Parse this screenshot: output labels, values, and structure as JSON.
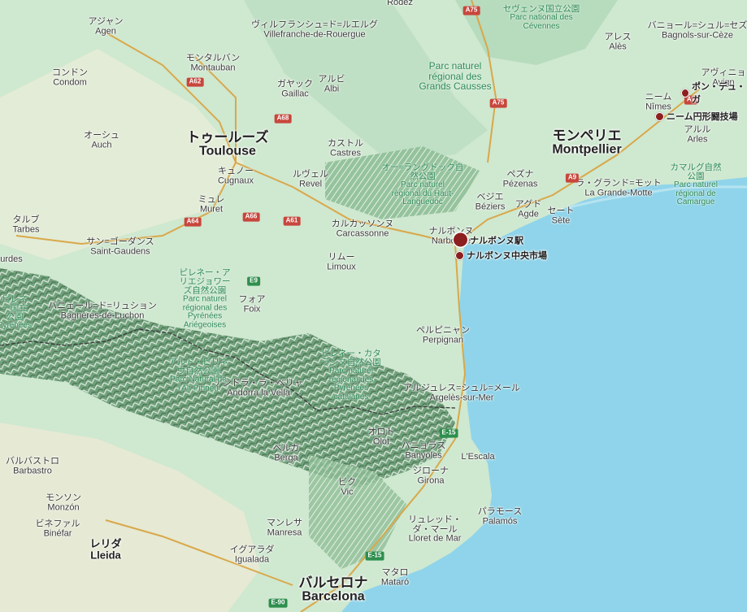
{
  "colors": {
    "sea": "#8fd4ea",
    "land": "#cfe8d0",
    "lowland": "#e6ecd8",
    "mountain": "#7fb68a",
    "border": "#3b3b3b",
    "motorway": "#d9a84a",
    "poi": "#8c1f1f"
  },
  "cities": [
    {
      "id": "rodez",
      "ja": "",
      "en": "Rodez"
    },
    {
      "id": "agen",
      "ja": "アジャン",
      "en": "Agen"
    },
    {
      "id": "villefranche",
      "ja": "ヴィルフランシュ=ド=ルエルグ",
      "en": "Villefranche-de-Rouergue"
    },
    {
      "id": "montauban",
      "ja": "モンタルバン",
      "en": "Montauban"
    },
    {
      "id": "condom",
      "ja": "コンドン",
      "en": "Condom"
    },
    {
      "id": "gaillac",
      "ja": "ガヤック",
      "en": "Gaillac"
    },
    {
      "id": "albi",
      "ja": "アルビ",
      "en": "Albi"
    },
    {
      "id": "auch",
      "ja": "オーシュ",
      "en": "Auch"
    },
    {
      "id": "castres",
      "ja": "カストル",
      "en": "Castres"
    },
    {
      "id": "cugnaux",
      "ja": "キュノー",
      "en": "Cugnaux"
    },
    {
      "id": "revel",
      "ja": "ルヴェル",
      "en": "Revel"
    },
    {
      "id": "muret",
      "ja": "ミュレ",
      "en": "Muret"
    },
    {
      "id": "tarbes",
      "ja": "タルブ",
      "en": "Tarbes"
    },
    {
      "id": "stgaudens",
      "ja": "サン=ゴーダンス",
      "en": "Saint-Gaudens"
    },
    {
      "id": "lourdes",
      "ja": "",
      "en": "urdes"
    },
    {
      "id": "carcassonne",
      "ja": "カルカッソンヌ",
      "en": "Carcassonne"
    },
    {
      "id": "limoux",
      "ja": "リムー",
      "en": "Limoux"
    },
    {
      "id": "foix",
      "ja": "フォア",
      "en": "Foix"
    },
    {
      "id": "luchon",
      "ja": "バニェール=ド=リュション",
      "en": "Bagnères-de-Luchon"
    },
    {
      "id": "narbonne",
      "ja": "ナルボンヌ",
      "en": "Narbonne"
    },
    {
      "id": "beziers",
      "ja": "ベジエ",
      "en": "Béziers"
    },
    {
      "id": "pezenas",
      "ja": "ペズナ",
      "en": "Pézenas"
    },
    {
      "id": "agde",
      "ja": "アグド",
      "en": "Agde"
    },
    {
      "id": "sete",
      "ja": "セート",
      "en": "Sète"
    },
    {
      "id": "grandemotte",
      "ja": "ラ・グランド=モット",
      "en": "La Grande-Motte"
    },
    {
      "id": "ales",
      "ja": "アレス",
      "en": "Alès"
    },
    {
      "id": "bagnols",
      "ja": "バニョール=シュル=セズ",
      "en": "Bagnols-sur-Cèze"
    },
    {
      "id": "avignon",
      "ja": "アヴィニョ",
      "en": "Avign"
    },
    {
      "id": "nimes",
      "ja": "ニーム",
      "en": "Nîmes"
    },
    {
      "id": "arles",
      "ja": "アルル",
      "en": "Arles"
    },
    {
      "id": "perpignan",
      "ja": "ペルピニャン",
      "en": "Perpignan"
    },
    {
      "id": "argeles",
      "ja": "アルジュレス=シュル=メール",
      "en": "Argelès-sur-Mer"
    },
    {
      "id": "andorra",
      "ja": "アンドラ・ラ・ベリャ",
      "en": "Andorra la Vella"
    },
    {
      "id": "olot",
      "ja": "オロト",
      "en": "Olot"
    },
    {
      "id": "banyoles",
      "ja": "バニョラス",
      "en": "Banyoles"
    },
    {
      "id": "lescala",
      "ja": "",
      "en": "L'Escala"
    },
    {
      "id": "girona",
      "ja": "ジローナ",
      "en": "Girona"
    },
    {
      "id": "berga",
      "ja": "ベルガ",
      "en": "Berga"
    },
    {
      "id": "vic",
      "ja": "ビク",
      "en": "Vic"
    },
    {
      "id": "barbastro",
      "ja": "バルバストロ",
      "en": "Barbastro"
    },
    {
      "id": "monzon",
      "ja": "モンソン",
      "en": "Monzón"
    },
    {
      "id": "binefar",
      "ja": "ビネファル",
      "en": "Binéfar"
    },
    {
      "id": "lleida",
      "ja": "レリダ",
      "en": "Lleida"
    },
    {
      "id": "manresa",
      "ja": "マンレサ",
      "en": "Manresa"
    },
    {
      "id": "igualada",
      "ja": "イグアラダ",
      "en": "Igualada"
    },
    {
      "id": "palamos",
      "ja": "パラモース",
      "en": "Palamós"
    },
    {
      "id": "lloret",
      "ja": "リュレッド・ダ・マール",
      "en": "Lloret de Mar"
    },
    {
      "id": "mataro",
      "ja": "マタロ",
      "en": "Mataró"
    }
  ],
  "big_cities": [
    {
      "id": "toulouse",
      "ja": "トゥールーズ",
      "en": "Toulouse"
    },
    {
      "id": "montpellier",
      "ja": "モンペリエ",
      "en": "Montpellier"
    },
    {
      "id": "barcelona",
      "ja": "バルセロナ",
      "en": "Barcelona"
    }
  ],
  "parks": [
    {
      "id": "cevennes",
      "ja": "セヴェンヌ国立公園",
      "en": "Parc national des Cévennes"
    },
    {
      "id": "grandscausses",
      "ja": "",
      "en": "Parc naturel régional des Grands Causses"
    },
    {
      "id": "hautlanguedoc",
      "ja": "オー=ラングドック自然公園",
      "en": "Parc naturel régional du Haut-Languedoc"
    },
    {
      "id": "camargue",
      "ja": "カマルグ自然公園",
      "en": "Parc naturel régional de Camargue"
    },
    {
      "id": "ariegeoises",
      "ja": "ピレネー・アリエジョワーズ自然公園",
      "en": "Parc naturel régional des Pyrénées Ariégeoises"
    },
    {
      "id": "catalanes",
      "ja": "ピレネー・カタランヌ自然公園",
      "en": "Parc naturel régional des Pyrénées catalanes"
    },
    {
      "id": "altpirineu",
      "ja": "アルト・ピリネウ自然公園",
      "en": "Parc Natural de l'Alt Pirineu"
    },
    {
      "id": "pyrenees",
      "ja": "ピレネー国立公園",
      "en": "Pyrénées"
    }
  ],
  "roads": [
    "A75",
    "A62",
    "A68",
    "A64",
    "A66",
    "A61",
    "A9",
    "E9",
    "E-15",
    "E-15",
    "E-90",
    "A75",
    "A7"
  ],
  "pois": [
    {
      "id": "narbonne-station",
      "label": "ナルボンヌ駅"
    },
    {
      "id": "narbonne-market",
      "label": "ナルボンヌ中央市場"
    },
    {
      "id": "pont-du-gard",
      "label": "ポン・デュ・ガ"
    },
    {
      "id": "nimes-arena",
      "label": "ニーム円形闘技場"
    }
  ]
}
